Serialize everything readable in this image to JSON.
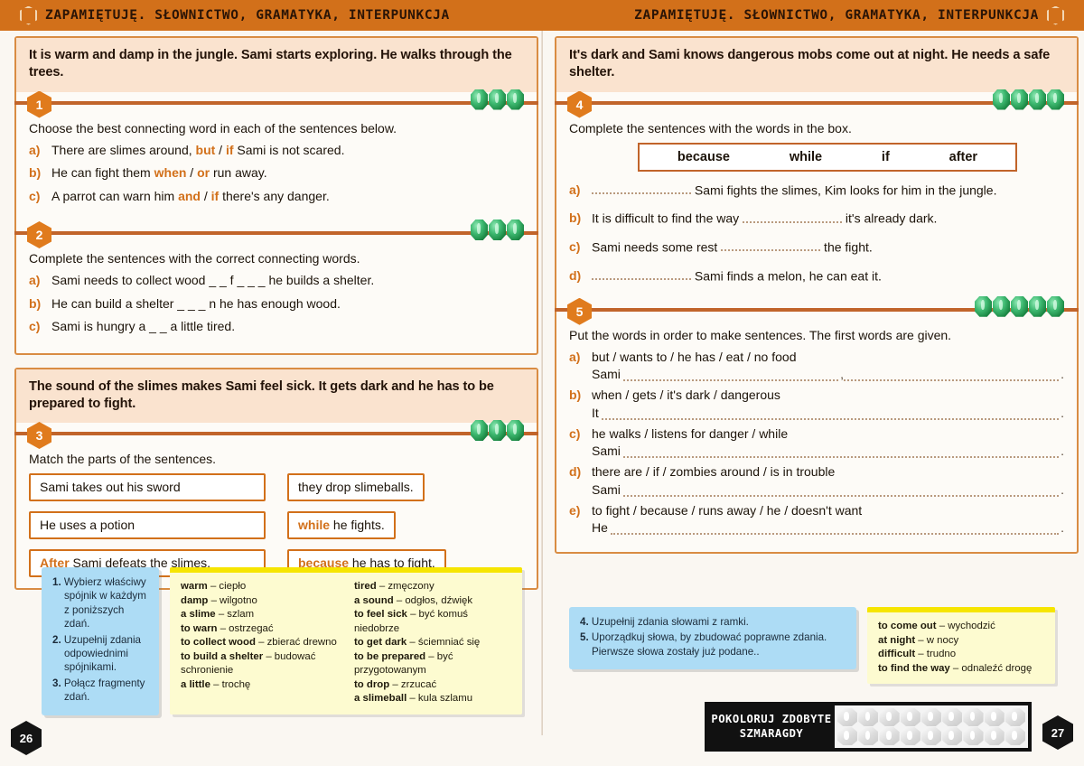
{
  "header": {
    "title_left": "ZAPAMIĘTUJĘ. SŁOWNICTWO, GRAMATYKA, INTERPUNKCJA",
    "title_right": "ZAPAMIĘTUJĘ. SŁOWNICTWO, GRAMATYKA, INTERPUNKCJA",
    "hex_icon": "hexagon-outline-icon"
  },
  "left_page": {
    "page_number": "26",
    "group1": {
      "intro": "It is warm and damp in the jungle. Sami starts exploring. He walks through the trees.",
      "ex1": {
        "number": "1",
        "gems": 3,
        "instruction": "Choose the best connecting word in each of the sentences below.",
        "items": [
          {
            "label": "a)",
            "pre": "There are slimes around, ",
            "kw1": "but",
            "mid": " / ",
            "kw2": "if",
            "post": " Sami is not scared."
          },
          {
            "label": "b)",
            "pre": "He can fight them ",
            "kw1": "when",
            "mid": " / ",
            "kw2": "or",
            "post": " run away."
          },
          {
            "label": "c)",
            "pre": "A parrot can warn him ",
            "kw1": "and",
            "mid": " / ",
            "kw2": "if",
            "post": " there's any danger."
          }
        ]
      },
      "ex2": {
        "number": "2",
        "gems": 3,
        "instruction": "Complete the sentences with the correct connecting words.",
        "items": [
          {
            "label": "a)",
            "text": "Sami needs to collect wood  _ _ f _ _ _  he builds a shelter."
          },
          {
            "label": "b)",
            "text": "He can build a shelter  _ _ _ n  he has enough wood."
          },
          {
            "label": "c)",
            "text": "Sami is hungry  a _ _  a little tired."
          }
        ]
      }
    },
    "group2": {
      "intro": "The sound of the slimes makes Sami feel sick. It gets dark and he has to be prepared to fight.",
      "ex3": {
        "number": "3",
        "gems": 3,
        "instruction": "Match the parts of the sentences.",
        "left_boxes": [
          {
            "kw": "",
            "text": "Sami takes out his sword"
          },
          {
            "kw": "",
            "text": "He uses a potion"
          },
          {
            "kw": "After",
            "text": " Sami defeats the slimes,"
          }
        ],
        "right_boxes": [
          {
            "kw": "",
            "text": "they drop slimeballs."
          },
          {
            "kw": "while",
            "text": " he fights."
          },
          {
            "kw": "because",
            "text": " he has to fight."
          }
        ]
      }
    },
    "hints_blue": [
      {
        "n": "1.",
        "text": "Wybierz właściwy spójnik w każdym z poniższych zdań."
      },
      {
        "n": "2.",
        "text": "Uzupełnij zdania odpowiednimi spójnikami."
      },
      {
        "n": "3.",
        "text": "Połącz fragmenty zdań."
      }
    ],
    "vocab_col1": [
      {
        "en": "warm",
        "pl": "– ciepło"
      },
      {
        "en": "damp",
        "pl": "– wilgotno"
      },
      {
        "en": "a slime",
        "pl": "– szlam"
      },
      {
        "en": "to warn",
        "pl": "– ostrzegać"
      },
      {
        "en": "to collect wood",
        "pl": "– zbierać drewno"
      },
      {
        "en": "to build a shelter",
        "pl": "– budować"
      },
      {
        "en": "",
        "pl": "schronienie"
      },
      {
        "en": "a little",
        "pl": "– trochę"
      }
    ],
    "vocab_col2": [
      {
        "en": "tired",
        "pl": "– zmęczony"
      },
      {
        "en": "a sound",
        "pl": "– odgłos, dźwięk"
      },
      {
        "en": "to feel sick",
        "pl": "– być komuś niedobrze"
      },
      {
        "en": "to get dark",
        "pl": "– ściemniać się"
      },
      {
        "en": "to be prepared",
        "pl": "– być"
      },
      {
        "en": "",
        "pl": "przygotowanym"
      },
      {
        "en": "to drop",
        "pl": "– zrzucać"
      },
      {
        "en": "a slimeball",
        "pl": "– kula szlamu"
      }
    ]
  },
  "right_page": {
    "page_number": "27",
    "group3": {
      "intro": "It's dark and Sami knows dangerous mobs come out at night. He needs a safe shelter.",
      "ex4": {
        "number": "4",
        "gems": 4,
        "instruction": "Complete the sentences with the words in the box.",
        "word_box": [
          "because",
          "while",
          "if",
          "after"
        ],
        "items": [
          {
            "label": "a)",
            "pre": "",
            "blank": 1,
            "post": " Sami fights the slimes, Kim looks for him in the jungle."
          },
          {
            "label": "b)",
            "pre": "It is difficult to find the way ",
            "blank": 1,
            "post": " it's already dark."
          },
          {
            "label": "c)",
            "pre": "Sami needs some rest ",
            "blank": 1,
            "post": " the fight."
          },
          {
            "label": "d)",
            "pre": "",
            "blank": 1,
            "post": " Sami finds a melon, he can eat it."
          }
        ]
      },
      "ex5": {
        "number": "5",
        "gems": 5,
        "instruction": "Put the words in order to make sentences. The first words are given.",
        "items": [
          {
            "label": "a)",
            "words": "but / wants to / he has / eat / no food",
            "lead": "Sami",
            "comma": true,
            "end": "."
          },
          {
            "label": "b)",
            "words": "when / gets / it's dark / dangerous",
            "lead": "It",
            "comma": false,
            "end": "."
          },
          {
            "label": "c)",
            "words": "he walks / listens for danger / while",
            "lead": "Sami",
            "comma": false,
            "end": "."
          },
          {
            "label": "d)",
            "words": "there are / if / zombies around / is in trouble",
            "lead": "Sami",
            "comma": false,
            "end": "."
          },
          {
            "label": "e)",
            "words": "to fight / because / runs away / he / doesn't want",
            "lead": "He",
            "comma": false,
            "end": "."
          }
        ]
      }
    },
    "hints_blue": [
      {
        "n": "4.",
        "text": "Uzupełnij zdania słowami  z ramki."
      },
      {
        "n": "5.",
        "text": "Uporządkuj słowa, by zbudować poprawne zdania. Pierwsze słowa zostały już podane.."
      }
    ],
    "vocab": [
      {
        "en": "to come out",
        "pl": "– wychodzić"
      },
      {
        "en": "at night",
        "pl": "– w nocy"
      },
      {
        "en": "difficult",
        "pl": "– trudno"
      },
      {
        "en": "to find the way",
        "pl": "– odnaleźć drogę"
      }
    ],
    "score_panel": {
      "label_line1": "POKOLORUJ ZDOBYTE",
      "label_line2": "SZMARAGDY",
      "gem_slots": 18
    }
  },
  "colors": {
    "header_bg": "#d2701a",
    "accent_orange": "#d2701a",
    "intro_bg": "#fae3cf",
    "rule": "#c1642a",
    "gem_green": "#2f9e57",
    "blue_hint": "#addcf5",
    "yellow_vocab": "#fdfbd0",
    "yellow_top": "#f6e500"
  }
}
